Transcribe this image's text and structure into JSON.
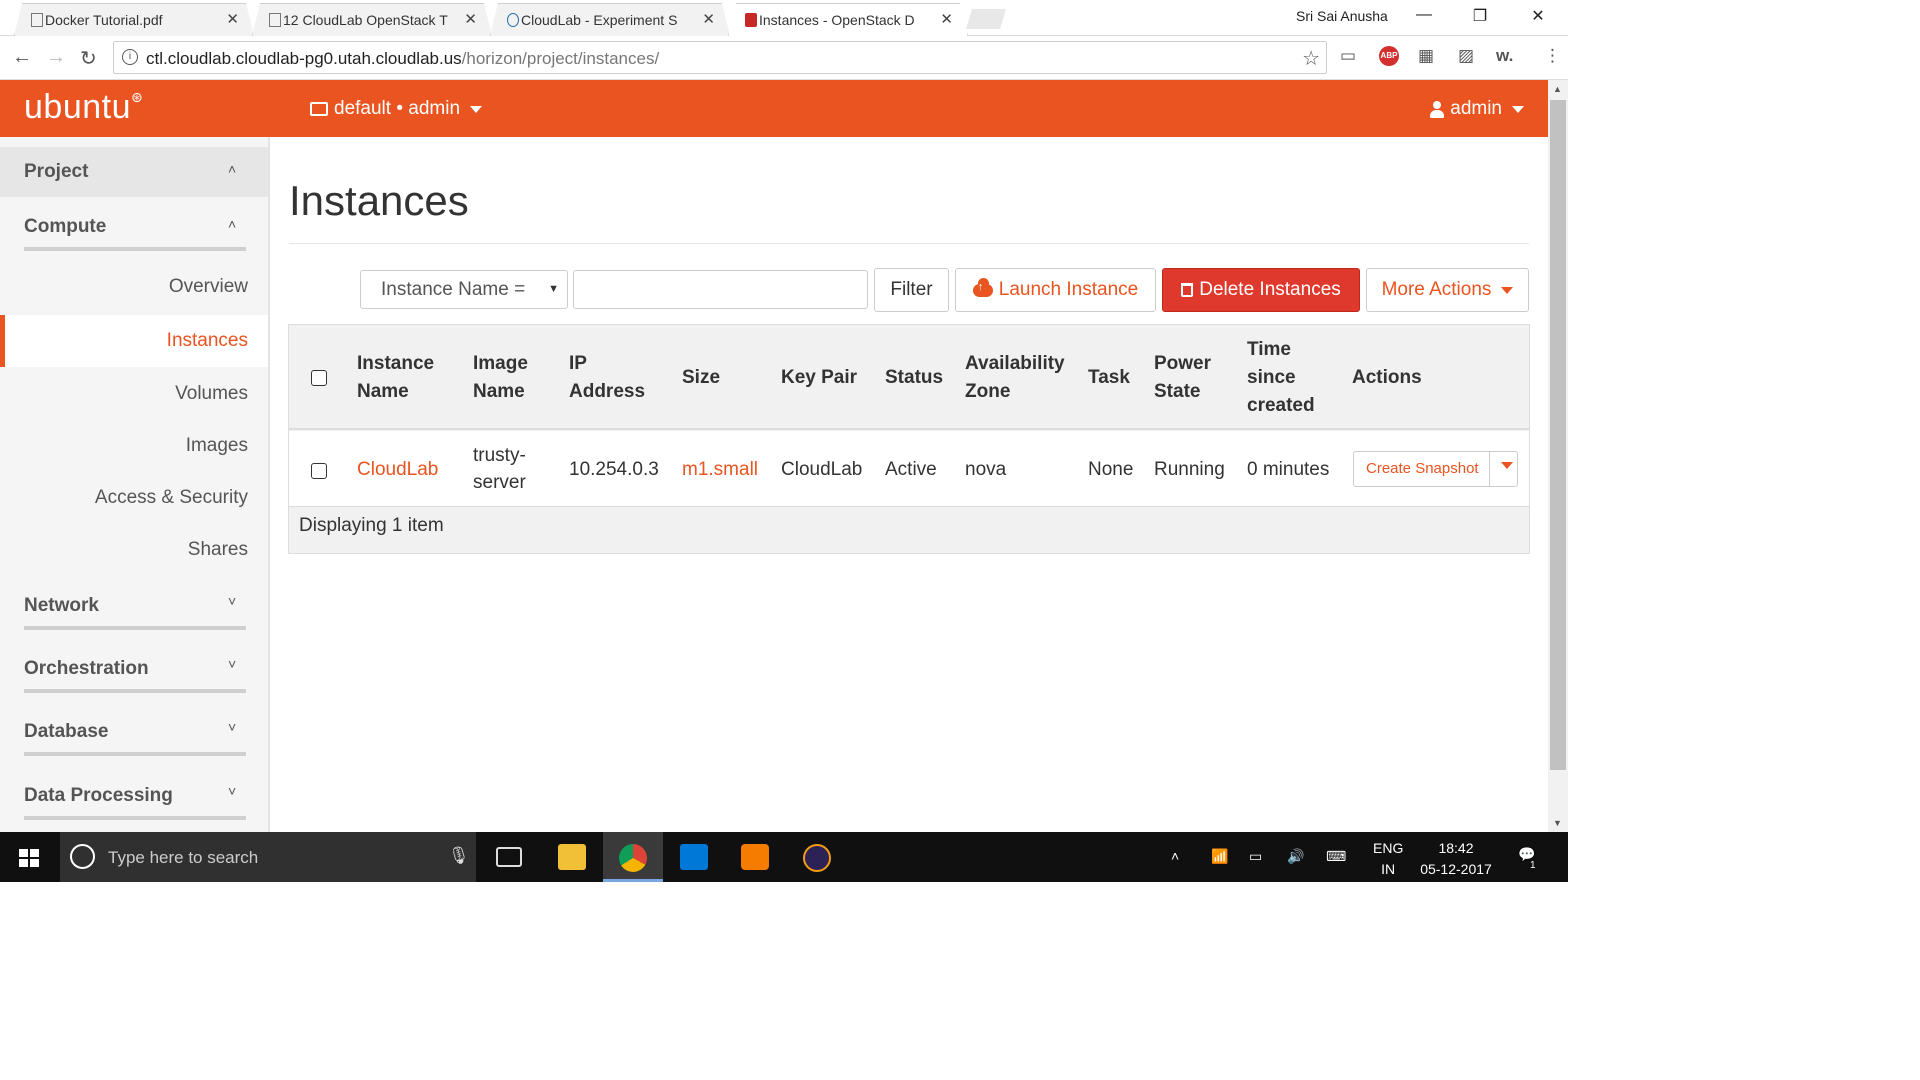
{
  "browser": {
    "tabs": [
      {
        "title": "Docker Tutorial.pdf"
      },
      {
        "title": "12 CloudLab OpenStack T"
      },
      {
        "title": "CloudLab - Experiment S"
      },
      {
        "title": "Instances - OpenStack D"
      }
    ],
    "window_user": "Sri Sai Anusha",
    "url_host": "ctl.cloudlab.cloudlab-pg0.utah.cloudlab.us",
    "url_path": "/horizon/project/instances/"
  },
  "header": {
    "logo": "ubuntu",
    "project_selector": "default • admin",
    "user_menu": "admin"
  },
  "sidebar": {
    "project": "Project",
    "compute": "Compute",
    "compute_items": [
      "Overview",
      "Instances",
      "Volumes",
      "Images",
      "Access & Security",
      "Shares"
    ],
    "network": "Network",
    "orchestration": "Orchestration",
    "database": "Database",
    "data_processing": "Data Processing"
  },
  "main": {
    "title": "Instances",
    "filter_field": "Instance Name =",
    "filter_value": "",
    "filter_button": "Filter",
    "launch_button": "Launch Instance",
    "delete_button": "Delete Instances",
    "more_actions": "More Actions",
    "columns": {
      "instance_name": [
        "Instance",
        "Name"
      ],
      "image_name": [
        "Image",
        "Name"
      ],
      "ip_address": [
        "IP",
        "Address"
      ],
      "size": "Size",
      "key_pair": "Key Pair",
      "status": "Status",
      "availability_zone": [
        "Availability",
        "Zone"
      ],
      "task": "Task",
      "power_state": [
        "Power",
        "State"
      ],
      "time_since_created": [
        "Time",
        "since",
        "created"
      ],
      "actions": "Actions"
    },
    "rows": [
      {
        "instance_name": "CloudLab",
        "image_name": [
          "trusty-",
          "server"
        ],
        "ip_address": "10.254.0.3",
        "size": "m1.small",
        "key_pair": "CloudLab",
        "status": "Active",
        "availability_zone": "nova",
        "task": "None",
        "power_state": "Running",
        "time_since_created": "0 minutes",
        "action": "Create Snapshot"
      }
    ],
    "footer": "Displaying 1 item"
  },
  "taskbar": {
    "search_placeholder": "Type here to search",
    "lang_top": "ENG",
    "lang_bottom": "IN",
    "time": "18:42",
    "date": "05-12-2017",
    "notifications": "1"
  },
  "colors": {
    "brand": "#e95420",
    "danger": "#df382c",
    "taskbar": "#101010"
  }
}
